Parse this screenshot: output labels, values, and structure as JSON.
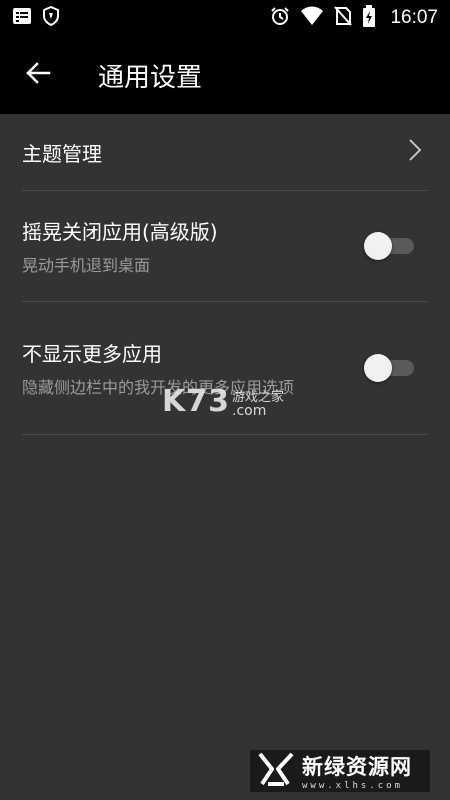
{
  "status_bar": {
    "time": "16:07",
    "left_icons": [
      "notes-icon",
      "shield-icon"
    ],
    "right_icons": [
      "alarm-icon",
      "wifi-icon",
      "no-sim-icon",
      "battery-charging-icon"
    ]
  },
  "app_bar": {
    "back_icon": "arrow-left-icon",
    "title": "通用设置"
  },
  "settings": [
    {
      "title": "主题管理",
      "control": "chevron"
    },
    {
      "title": "摇晃关闭应用(高级版)",
      "subtitle": "晃动手机退到桌面",
      "control": "toggle",
      "enabled": false
    },
    {
      "title": "不显示更多应用",
      "subtitle": "隐藏侧边栏中的我开发的更多应用选项",
      "control": "toggle",
      "enabled": false
    }
  ],
  "watermarks": {
    "k73": {
      "logo": "K73",
      "tagline": "游戏之家",
      "domain": ".com"
    },
    "xlhs": {
      "name": "新绿资源网",
      "url": "www.xlhs.com"
    }
  },
  "colors": {
    "background": "#333333",
    "app_bar": "#000000",
    "divider": "#4a4a4a",
    "secondary_text": "#9a9a9a",
    "toggle_track_off": "#5a5a5a",
    "toggle_thumb": "#f1f1f1"
  }
}
